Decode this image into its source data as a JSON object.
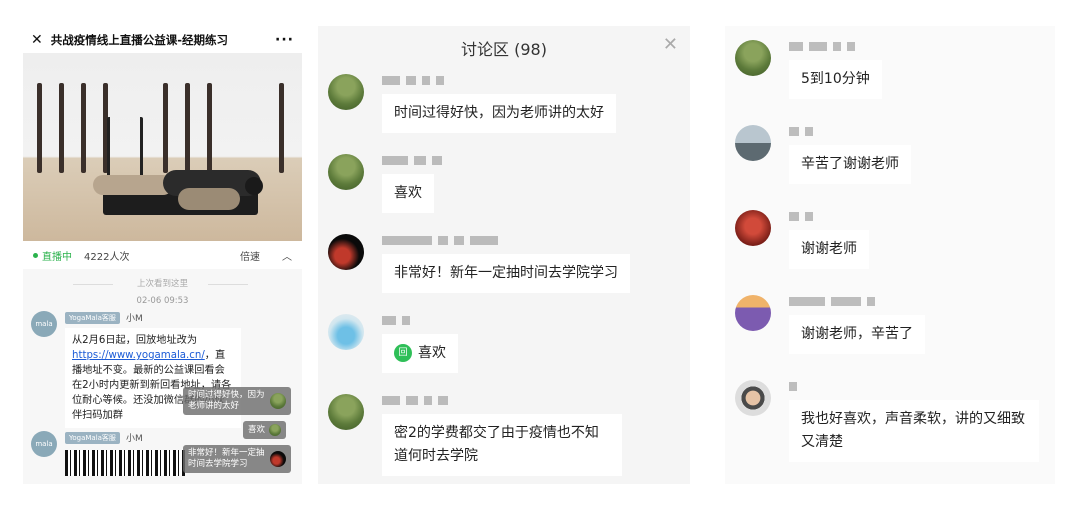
{
  "panel1": {
    "title": "共战疫情线上直播公益课-经期练习",
    "more": "···",
    "live_label": "直播中",
    "viewers": "4222人次",
    "speed": "倍速",
    "last_seen": "上次看到这里",
    "timestamp": "02-06 09:53",
    "messages": [
      {
        "avatar_text": "mala",
        "tag": "YogaMala客服",
        "name": "小M",
        "text_before": "从2月6日起，回放地址改为",
        "link": "https://www.yogamala.cn/",
        "text_after": "，直播地址不变。最新的公益课回看会在2小时内更新到新回看地址，请各位耐心等候。还没加微信群的小伙伴扫码加群"
      },
      {
        "avatar_text": "mala",
        "tag": "YogaMala客服",
        "name": "小M"
      }
    ],
    "overlays": [
      "时间过得好快，因为老师讲的太好",
      "喜欢",
      "非常好！新年一定抽时间去学院学习"
    ]
  },
  "panel2": {
    "title": "讨论区 (98)",
    "close": "✕",
    "comments": [
      {
        "avatar": "grass",
        "text": "时间过得好快，因为老师讲的太好"
      },
      {
        "avatar": "grass",
        "text": "喜欢"
      },
      {
        "avatar": "dark",
        "text": "非常好！新年一定抽时间去学院学习"
      },
      {
        "avatar": "blue",
        "icon": "回",
        "text": "喜欢"
      },
      {
        "avatar": "grass",
        "text": "密2的学费都交了由于疫情也不知道何时去学院"
      }
    ]
  },
  "panel3": {
    "comments": [
      {
        "avatar": "grass",
        "text": "5到10分钟"
      },
      {
        "avatar": "city",
        "text": "辛苦了谢谢老师"
      },
      {
        "avatar": "red",
        "text": "谢谢老师"
      },
      {
        "avatar": "lavender",
        "text": "谢谢老师，辛苦了"
      },
      {
        "avatar": "face",
        "text": "我也好喜欢，声音柔软，讲的又细致又清楚"
      }
    ]
  },
  "colors": {
    "live_green": "#2bb24c",
    "link_blue": "#1b5bd6",
    "wechat_green": "#2fbf58"
  }
}
